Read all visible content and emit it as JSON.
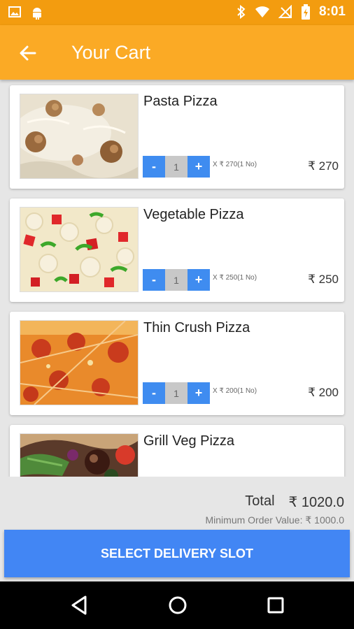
{
  "status": {
    "time": "8:01",
    "icons": [
      "image-icon",
      "android-icon",
      "bluetooth-icon",
      "wifi-icon",
      "no-signal-icon",
      "battery-charging-icon"
    ]
  },
  "app_bar": {
    "title": "Your Cart",
    "back_icon": "arrow-left-icon"
  },
  "items": [
    {
      "name": "Pasta Pizza",
      "qty": "1",
      "unit_price": "X ₹ 270(1 No)",
      "price": "₹ 270",
      "minus": "-",
      "plus": "+",
      "image": "pasta-pizza"
    },
    {
      "name": "Vegetable Pizza",
      "qty": "1",
      "unit_price": "X ₹ 250(1 No)",
      "price": "₹ 250",
      "minus": "-",
      "plus": "+",
      "image": "vegetable-pizza"
    },
    {
      "name": "Thin Crush Pizza",
      "qty": "1",
      "unit_price": "X ₹ 200(1 No)",
      "price": "₹ 200",
      "minus": "-",
      "plus": "+",
      "image": "thin-crust-pizza"
    },
    {
      "name": "Grill Veg Pizza",
      "image": "grill-veg-pizza"
    }
  ],
  "summary": {
    "total_label": "Total",
    "total_value": "₹ 1020.0",
    "min_order": "Minimum Order Value: ₹ 1000.0"
  },
  "cta": {
    "label": "SELECT DELIVERY SLOT"
  },
  "colors": {
    "status_bar": "#f39c0f",
    "app_bar": "#fbaa25",
    "accent": "#3f8cf0",
    "cta": "#4286f4"
  }
}
